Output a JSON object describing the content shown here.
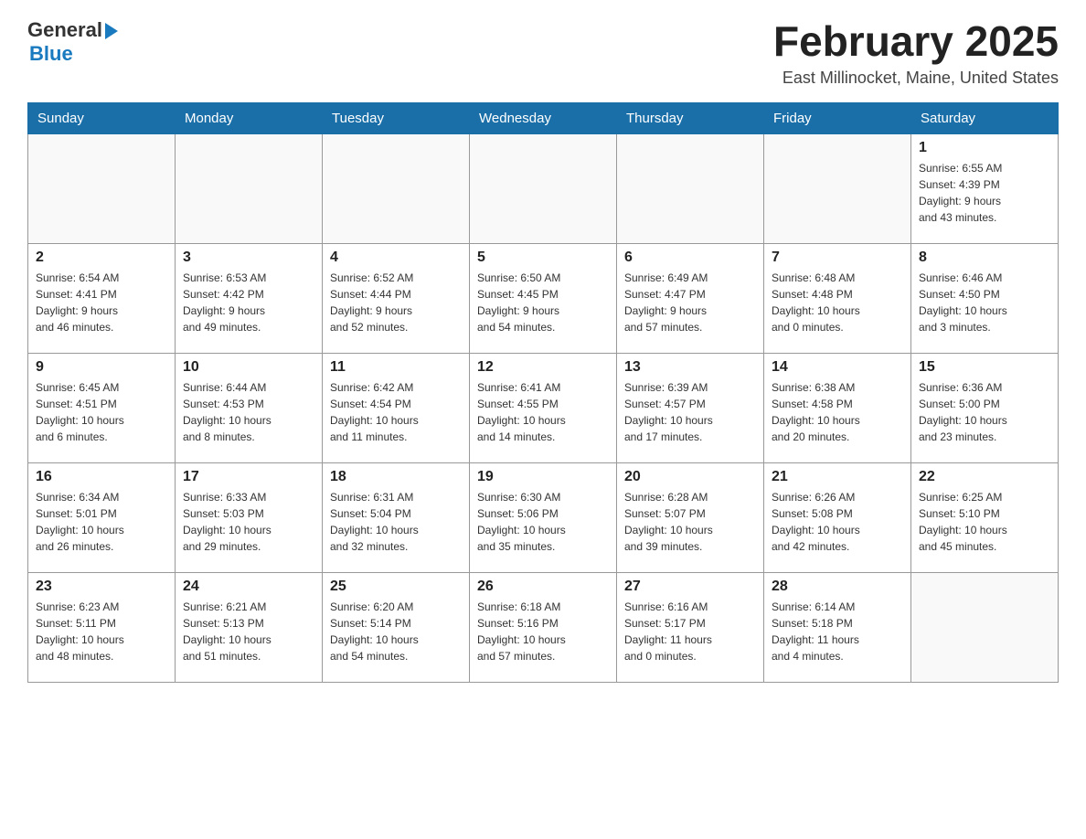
{
  "header": {
    "logo_general": "General",
    "logo_blue": "Blue",
    "month_title": "February 2025",
    "location": "East Millinocket, Maine, United States"
  },
  "weekdays": [
    "Sunday",
    "Monday",
    "Tuesday",
    "Wednesday",
    "Thursday",
    "Friday",
    "Saturday"
  ],
  "weeks": [
    [
      {
        "day": "",
        "info": ""
      },
      {
        "day": "",
        "info": ""
      },
      {
        "day": "",
        "info": ""
      },
      {
        "day": "",
        "info": ""
      },
      {
        "day": "",
        "info": ""
      },
      {
        "day": "",
        "info": ""
      },
      {
        "day": "1",
        "info": "Sunrise: 6:55 AM\nSunset: 4:39 PM\nDaylight: 9 hours\nand 43 minutes."
      }
    ],
    [
      {
        "day": "2",
        "info": "Sunrise: 6:54 AM\nSunset: 4:41 PM\nDaylight: 9 hours\nand 46 minutes."
      },
      {
        "day": "3",
        "info": "Sunrise: 6:53 AM\nSunset: 4:42 PM\nDaylight: 9 hours\nand 49 minutes."
      },
      {
        "day": "4",
        "info": "Sunrise: 6:52 AM\nSunset: 4:44 PM\nDaylight: 9 hours\nand 52 minutes."
      },
      {
        "day": "5",
        "info": "Sunrise: 6:50 AM\nSunset: 4:45 PM\nDaylight: 9 hours\nand 54 minutes."
      },
      {
        "day": "6",
        "info": "Sunrise: 6:49 AM\nSunset: 4:47 PM\nDaylight: 9 hours\nand 57 minutes."
      },
      {
        "day": "7",
        "info": "Sunrise: 6:48 AM\nSunset: 4:48 PM\nDaylight: 10 hours\nand 0 minutes."
      },
      {
        "day": "8",
        "info": "Sunrise: 6:46 AM\nSunset: 4:50 PM\nDaylight: 10 hours\nand 3 minutes."
      }
    ],
    [
      {
        "day": "9",
        "info": "Sunrise: 6:45 AM\nSunset: 4:51 PM\nDaylight: 10 hours\nand 6 minutes."
      },
      {
        "day": "10",
        "info": "Sunrise: 6:44 AM\nSunset: 4:53 PM\nDaylight: 10 hours\nand 8 minutes."
      },
      {
        "day": "11",
        "info": "Sunrise: 6:42 AM\nSunset: 4:54 PM\nDaylight: 10 hours\nand 11 minutes."
      },
      {
        "day": "12",
        "info": "Sunrise: 6:41 AM\nSunset: 4:55 PM\nDaylight: 10 hours\nand 14 minutes."
      },
      {
        "day": "13",
        "info": "Sunrise: 6:39 AM\nSunset: 4:57 PM\nDaylight: 10 hours\nand 17 minutes."
      },
      {
        "day": "14",
        "info": "Sunrise: 6:38 AM\nSunset: 4:58 PM\nDaylight: 10 hours\nand 20 minutes."
      },
      {
        "day": "15",
        "info": "Sunrise: 6:36 AM\nSunset: 5:00 PM\nDaylight: 10 hours\nand 23 minutes."
      }
    ],
    [
      {
        "day": "16",
        "info": "Sunrise: 6:34 AM\nSunset: 5:01 PM\nDaylight: 10 hours\nand 26 minutes."
      },
      {
        "day": "17",
        "info": "Sunrise: 6:33 AM\nSunset: 5:03 PM\nDaylight: 10 hours\nand 29 minutes."
      },
      {
        "day": "18",
        "info": "Sunrise: 6:31 AM\nSunset: 5:04 PM\nDaylight: 10 hours\nand 32 minutes."
      },
      {
        "day": "19",
        "info": "Sunrise: 6:30 AM\nSunset: 5:06 PM\nDaylight: 10 hours\nand 35 minutes."
      },
      {
        "day": "20",
        "info": "Sunrise: 6:28 AM\nSunset: 5:07 PM\nDaylight: 10 hours\nand 39 minutes."
      },
      {
        "day": "21",
        "info": "Sunrise: 6:26 AM\nSunset: 5:08 PM\nDaylight: 10 hours\nand 42 minutes."
      },
      {
        "day": "22",
        "info": "Sunrise: 6:25 AM\nSunset: 5:10 PM\nDaylight: 10 hours\nand 45 minutes."
      }
    ],
    [
      {
        "day": "23",
        "info": "Sunrise: 6:23 AM\nSunset: 5:11 PM\nDaylight: 10 hours\nand 48 minutes."
      },
      {
        "day": "24",
        "info": "Sunrise: 6:21 AM\nSunset: 5:13 PM\nDaylight: 10 hours\nand 51 minutes."
      },
      {
        "day": "25",
        "info": "Sunrise: 6:20 AM\nSunset: 5:14 PM\nDaylight: 10 hours\nand 54 minutes."
      },
      {
        "day": "26",
        "info": "Sunrise: 6:18 AM\nSunset: 5:16 PM\nDaylight: 10 hours\nand 57 minutes."
      },
      {
        "day": "27",
        "info": "Sunrise: 6:16 AM\nSunset: 5:17 PM\nDaylight: 11 hours\nand 0 minutes."
      },
      {
        "day": "28",
        "info": "Sunrise: 6:14 AM\nSunset: 5:18 PM\nDaylight: 11 hours\nand 4 minutes."
      },
      {
        "day": "",
        "info": ""
      }
    ]
  ]
}
